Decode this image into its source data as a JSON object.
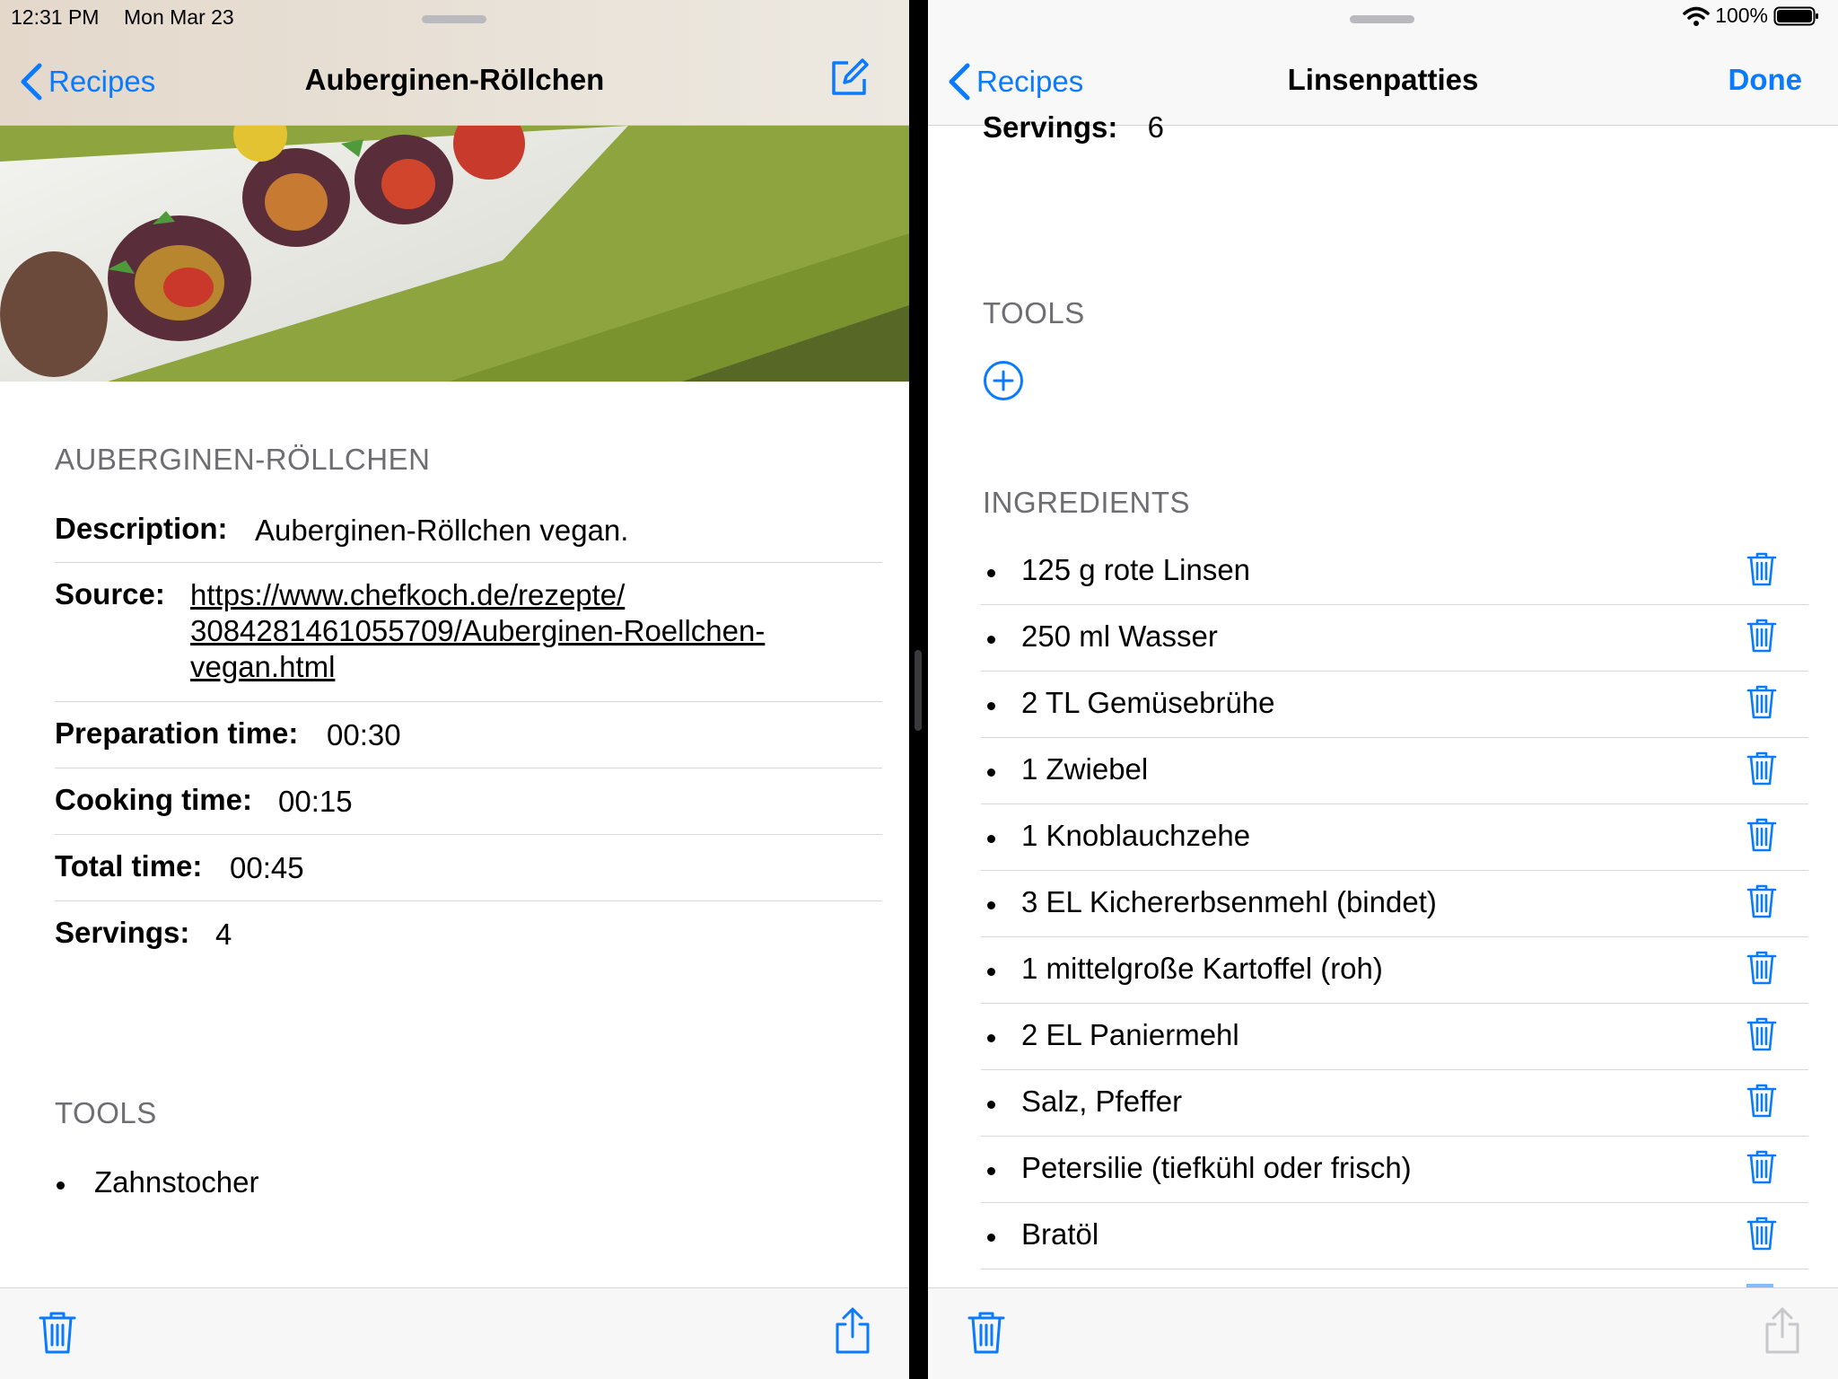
{
  "status_bar": {
    "time": "12:31 PM",
    "date": "Mon Mar 23",
    "battery": "100%"
  },
  "left": {
    "nav": {
      "back_label": "Recipes",
      "title": "Auberginen-Röllchen"
    },
    "section_title": "AUBERGINEN-RÖLLCHEN",
    "details": {
      "description_label": "Description:",
      "description_value": "Auberginen-Röllchen vegan.",
      "source_label": "Source:",
      "source_line1": "https://www.chefkoch.de/rezepte/",
      "source_line2": "3084281461055709/Auberginen-Roellchen-",
      "source_line3": "vegan.html",
      "prep_label": "Preparation time:",
      "prep_value": "00:30",
      "cook_label": "Cooking time:",
      "cook_value": "00:15",
      "total_label": "Total time:",
      "total_value": "00:45",
      "servings_label": "Servings:",
      "servings_value": "4"
    },
    "tools_header": "TOOLS",
    "tools": [
      "Zahnstocher"
    ]
  },
  "right": {
    "nav": {
      "back_label": "Recipes",
      "title": "Linsenpatties",
      "done_label": "Done"
    },
    "servings_label": "Servings:",
    "servings_value": "6",
    "tools_header": "TOOLS",
    "ingredients_header": "INGREDIENTS",
    "ingredients": [
      "125 g rote Linsen",
      "250 ml Wasser",
      "2 TL Gemüsebrühe",
      "1 Zwiebel",
      "1 Knoblauchzehe",
      "3 EL Kichererbsenmehl (bindet)",
      "1 mittelgroße Kartoffel (roh)",
      "2 EL Paniermehl",
      "Salz, Pfeffer",
      "Petersilie (tiefkühl oder frisch)",
      "Bratöl"
    ]
  },
  "colors": {
    "accent": "#0a7aff",
    "secondary_text": "#6d6d72",
    "separator": "#d8d8dc"
  },
  "icons": [
    "chevron-left-icon",
    "compose-icon",
    "trash-icon",
    "share-icon",
    "add-circle-icon",
    "wifi-icon",
    "battery-icon"
  ]
}
